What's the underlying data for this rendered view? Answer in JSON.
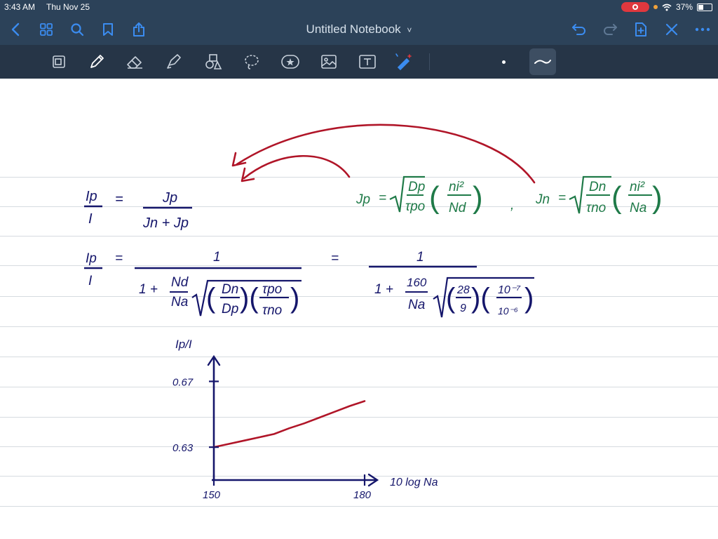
{
  "status_bar": {
    "time": "3:43 AM",
    "date": "Thu Nov 25",
    "battery": "37%",
    "battery_level": 0.37
  },
  "nav_bar": {
    "title": "Untitled Notebook",
    "title_chevron": "˅",
    "left_icons": [
      "back-icon",
      "grid-icon",
      "search-icon",
      "bookmark-icon",
      "share-icon"
    ],
    "right_icons": [
      "undo-icon",
      "redo-icon",
      "add-page-icon",
      "close-icon",
      "more-icon"
    ]
  },
  "toolbar": {
    "tools": [
      "zoom-window-icon",
      "pen-icon",
      "eraser-icon",
      "highlighter-icon",
      "shapes-icon",
      "lasso-icon",
      "sticker-icon",
      "image-icon",
      "text-icon",
      "laser-pointer-icon"
    ],
    "selected_tool": "pen-icon",
    "stroke_widths": [
      "thin-dot",
      "medium-stroke"
    ]
  },
  "colors": {
    "ink_navy": "#15166b",
    "ink_green": "#1f7a48",
    "ink_red": "#b01528",
    "chrome_dark": "#2c4259",
    "accent_blue": "#3b8cf0"
  },
  "notes": {
    "eq1": {
      "lhs_num": "Ip",
      "lhs_den": "I",
      "equals": "=",
      "rhs_num": "Jp",
      "rhs_den": "Jn + Jp"
    },
    "jp_def": {
      "label": "Jp",
      "equals": "=",
      "frac_num": "Dp",
      "frac_den": "τpo",
      "paren_num": "ni²",
      "paren_den": "Nd",
      "sep": ","
    },
    "jn_def": {
      "label": "Jn",
      "equals": "=",
      "frac_num": "Dn",
      "frac_den": "τno",
      "paren_num": "ni²",
      "paren_den": "Na"
    },
    "eq2": {
      "lhs_num": "Ip",
      "lhs_den": "I",
      "equals": "=",
      "num": "1",
      "den_prefix": "1 +",
      "ratio_num": "Nd",
      "ratio_den": "Na",
      "d_num": "Dn",
      "d_den": "Dp",
      "t_num": "τpo",
      "t_den": "τno"
    },
    "eq3": {
      "equals": "=",
      "num": "1",
      "den_prefix": "1 +",
      "ratio_num": "160",
      "ratio_den": "Na",
      "d_num": "28",
      "d_den": "9",
      "t_num": "10⁻⁷",
      "t_den": "10⁻⁶"
    }
  },
  "chart_data": {
    "type": "line",
    "ylabel": "Ip/I",
    "xlabel": "10 log Na",
    "x_ticks": [
      "150",
      "180"
    ],
    "y_ticks": [
      "0.63",
      "0.67"
    ],
    "xlim": [
      150,
      180
    ],
    "ylim": [
      0.61,
      0.68
    ],
    "series": [
      {
        "x": [
          150,
          153,
          156,
          159,
          162,
          165,
          168,
          171,
          174,
          177,
          180
        ],
        "y": [
          0.63,
          0.632,
          0.634,
          0.636,
          0.638,
          0.6415,
          0.6445,
          0.648,
          0.6515,
          0.655,
          0.658
        ]
      }
    ]
  }
}
